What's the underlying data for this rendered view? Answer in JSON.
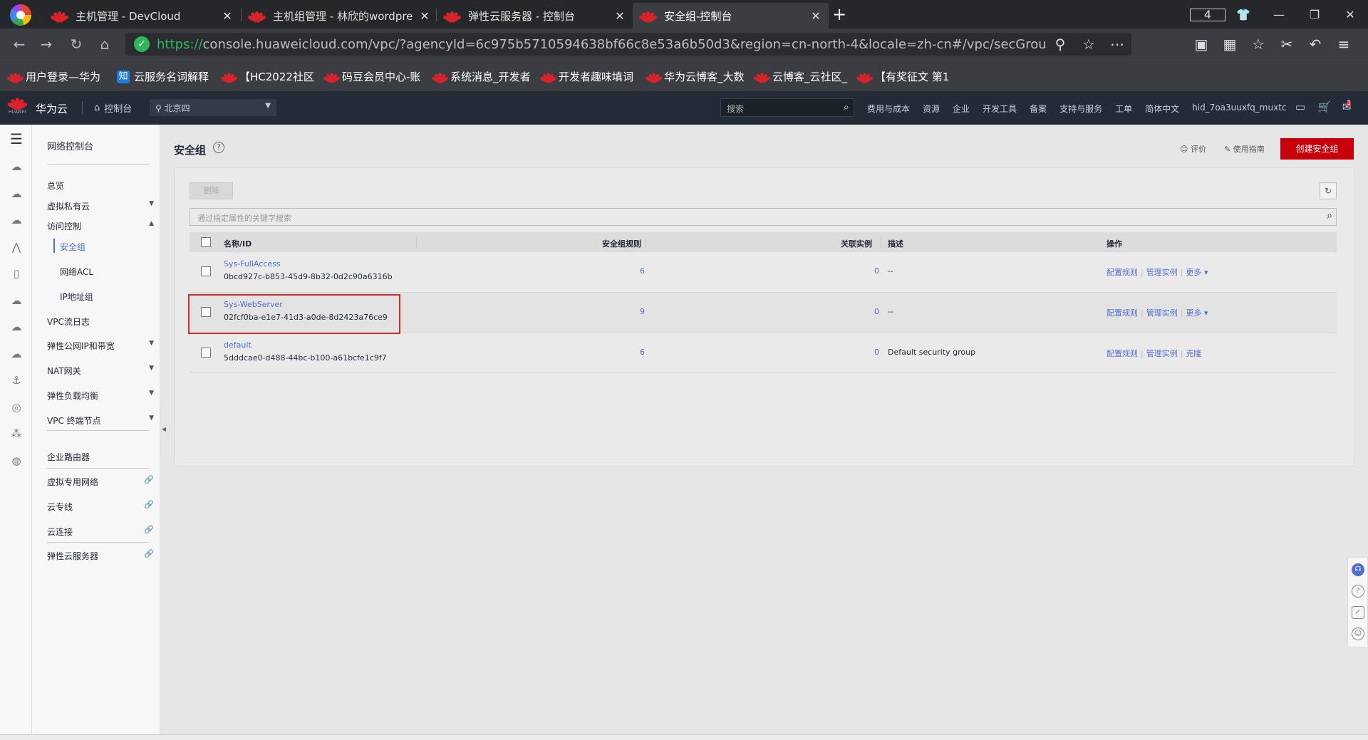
{
  "browser": {
    "tabs": [
      {
        "title": "主机管理 - DevCloud",
        "active": false
      },
      {
        "title": "主机组管理 - 林欣的wordpre",
        "active": false
      },
      {
        "title": "弹性云服务器 - 控制台",
        "active": false
      },
      {
        "title": "安全组-控制台",
        "active": true
      }
    ],
    "tab_count": "4",
    "url_protocol": "https://",
    "url_rest": "console.huaweicloud.com/vpc/?agencyId=6c975b5710594638bf66c8e53a6b50d3&region=cn-north-4&locale=zh-cn#/vpc/secGroups",
    "bookmarks": [
      {
        "label": "用户登录—华为",
        "icon": "huawei"
      },
      {
        "label": "云服务名词解释",
        "icon": "zhihu"
      },
      {
        "label": "【HC2022社区",
        "icon": "huawei"
      },
      {
        "label": "码豆会员中心-账",
        "icon": "huawei"
      },
      {
        "label": "系统消息_开发者",
        "icon": "huawei"
      },
      {
        "label": "开发者趣味填词",
        "icon": "huawei"
      },
      {
        "label": "华为云博客_大数",
        "icon": "huawei"
      },
      {
        "label": "云博客_云社区_",
        "icon": "huawei"
      },
      {
        "label": "【有奖征文 第1",
        "icon": "huawei"
      }
    ]
  },
  "header": {
    "logo_text": "HUAWEI",
    "brand": "华为云",
    "console_label": "控制台",
    "region": "北京四",
    "search_placeholder": "搜索",
    "menu": [
      "费用与成本",
      "资源",
      "企业",
      "开发工具",
      "备案",
      "支持与服务",
      "工单",
      "简体中文",
      "hid_7oa3uuxfq_muxtc"
    ],
    "notification_count": "1"
  },
  "sidebar": {
    "title": "网络控制台",
    "items": [
      {
        "label": "总览"
      },
      {
        "label": "虚拟私有云",
        "expand": "▼"
      },
      {
        "label": "访问控制",
        "expand": "▲"
      },
      {
        "label": "VPC流日志"
      },
      {
        "label": "弹性公网IP和带宽",
        "expand": "▼"
      },
      {
        "label": "NAT网关",
        "expand": "▼"
      },
      {
        "label": "弹性负载均衡",
        "expand": "▼"
      },
      {
        "label": "VPC 终端节点",
        "expand": "▼"
      },
      {
        "label": "企业路由器"
      },
      {
        "label": "虚拟专用网络"
      },
      {
        "label": "云专线"
      },
      {
        "label": "云连接"
      },
      {
        "label": "弹性云服务器"
      }
    ],
    "sub_items": [
      "安全组",
      "网络ACL",
      "IP地址组"
    ]
  },
  "page": {
    "title": "安全组",
    "feedback": "评价",
    "guide": "使用指南",
    "create_button": "创建安全组",
    "delete_button": "删除",
    "search_placeholder": "通过指定属性的关键字搜索",
    "columns": {
      "name": "名称/ID",
      "rules": "安全组规则",
      "instances": "关联实例",
      "description": "描述",
      "actions": "操作"
    },
    "rows": [
      {
        "name": "Sys-FullAccess",
        "id": "0bcd927c-b853-45d9-8b32-0d2c90a6316b",
        "rules": "6",
        "instances": "0",
        "description": "--",
        "op1": "配置规则",
        "op2": "管理实例",
        "op3": "更多"
      },
      {
        "name": "Sys-WebServer",
        "id": "02fcf0ba-e1e7-41d3-a0de-8d2423a76ce9",
        "rules": "9",
        "instances": "0",
        "description": "--",
        "op1": "配置规则",
        "op2": "管理实例",
        "op3": "更多"
      },
      {
        "name": "default",
        "id": "5dddcae0-d488-44bc-b100-a61bcfe1c9f7",
        "rules": "6",
        "instances": "0",
        "description": "Default security group",
        "op1": "配置规则",
        "op2": "管理实例",
        "op3": "克隆"
      }
    ]
  },
  "colors": {
    "brand_red": "#c7000b",
    "link_blue": "#526ecc",
    "highlight_red": "#e02a2a"
  }
}
